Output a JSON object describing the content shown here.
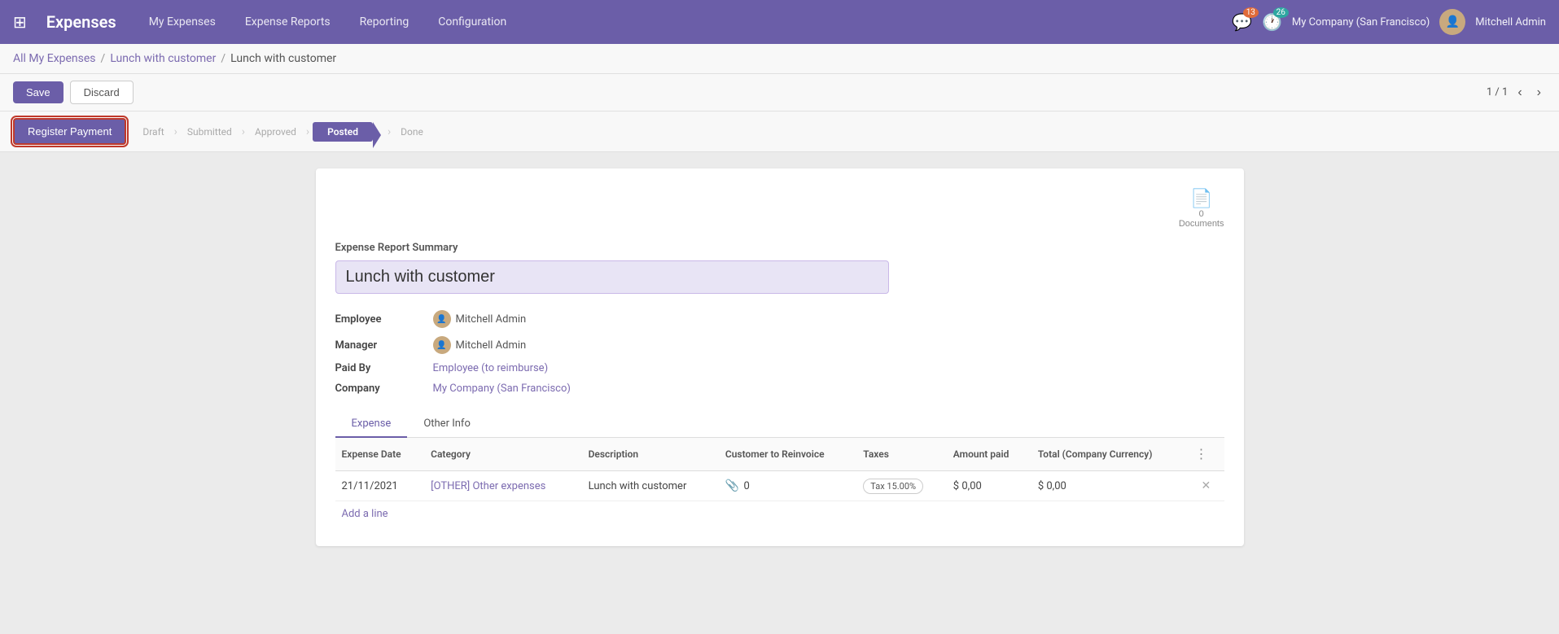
{
  "app": {
    "title": "Expenses",
    "grid_icon": "⊞"
  },
  "nav": {
    "items": [
      {
        "label": "My Expenses",
        "id": "my-expenses"
      },
      {
        "label": "Expense Reports",
        "id": "expense-reports"
      },
      {
        "label": "Reporting",
        "id": "reporting"
      },
      {
        "label": "Configuration",
        "id": "configuration"
      }
    ]
  },
  "notifications": {
    "chat_count": "13",
    "activity_count": "26"
  },
  "user": {
    "company": "My Company (San Francisco)",
    "name": "Mitchell Admin"
  },
  "breadcrumb": {
    "parts": [
      "All My Expenses",
      "Lunch with customer",
      "Lunch with customer"
    ]
  },
  "toolbar": {
    "save_label": "Save",
    "discard_label": "Discard",
    "pager": "1 / 1"
  },
  "actions": {
    "register_payment_label": "Register Payment"
  },
  "status_pipeline": {
    "steps": [
      "Draft",
      "Submitted",
      "Approved",
      "Posted",
      "Done"
    ],
    "active": "Posted"
  },
  "documents": {
    "count": "0",
    "label": "Documents"
  },
  "form": {
    "section_title": "Expense Report Summary",
    "expense_name": "Lunch with customer",
    "fields": {
      "employee_label": "Employee",
      "employee_value": "Mitchell Admin",
      "manager_label": "Manager",
      "manager_value": "Mitchell Admin",
      "paid_by_label": "Paid By",
      "paid_by_value": "Employee (to reimburse)",
      "company_label": "Company",
      "company_value": "My Company (San Francisco)"
    }
  },
  "tabs": [
    {
      "label": "Expense",
      "active": true
    },
    {
      "label": "Other Info",
      "active": false
    }
  ],
  "table": {
    "headers": [
      {
        "label": "Expense Date",
        "key": "date"
      },
      {
        "label": "Category",
        "key": "category"
      },
      {
        "label": "Description",
        "key": "description"
      },
      {
        "label": "Customer to Reinvoice",
        "key": "customer"
      },
      {
        "label": "Taxes",
        "key": "taxes"
      },
      {
        "label": "Amount paid",
        "key": "amount"
      },
      {
        "label": "Total (Company Currency)",
        "key": "total"
      }
    ],
    "rows": [
      {
        "date": "21/11/2021",
        "category": "[OTHER] Other expenses",
        "description": "Lunch with customer",
        "attachment_count": "0",
        "taxes": "Tax 15.00%",
        "amount": "$ 0,00",
        "total": "$ 0,00"
      }
    ],
    "add_line_label": "Add a line"
  }
}
